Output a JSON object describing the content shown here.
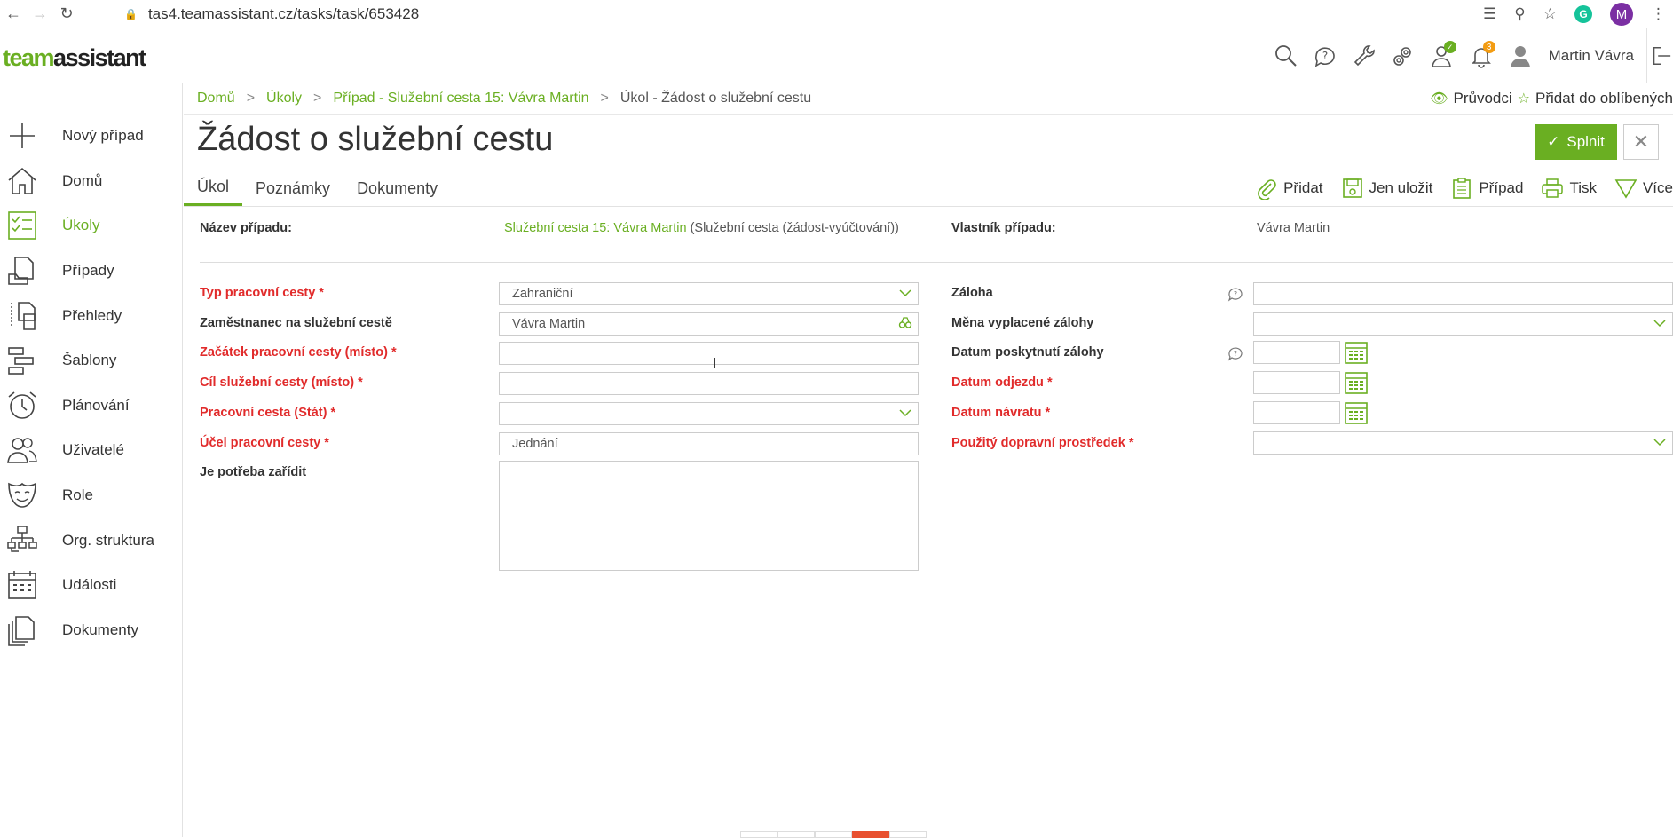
{
  "browser": {
    "url": "tas4.teamassistant.cz/tasks/task/653428",
    "profile_initial": "M",
    "grammarly": "G"
  },
  "app": {
    "logo_team": "team",
    "logo_assistant": "assistant",
    "user_name": "Martin Vávra",
    "notification_count": "3"
  },
  "sidebar": {
    "items": [
      {
        "label": "Nový případ",
        "icon": "plus-icon"
      },
      {
        "label": "Domů",
        "icon": "home-icon"
      },
      {
        "label": "Úkoly",
        "icon": "tasks-icon",
        "active": true
      },
      {
        "label": "Případy",
        "icon": "cases-icon"
      },
      {
        "label": "Přehledy",
        "icon": "overviews-icon"
      },
      {
        "label": "Šablony",
        "icon": "templates-icon"
      },
      {
        "label": "Plánování",
        "icon": "alarm-clock-icon"
      },
      {
        "label": "Uživatelé",
        "icon": "users-icon"
      },
      {
        "label": "Role",
        "icon": "mask-icon"
      },
      {
        "label": "Org. struktura",
        "icon": "org-chart-icon"
      },
      {
        "label": "Události",
        "icon": "calendar-icon"
      },
      {
        "label": "Dokumenty",
        "icon": "documents-icon"
      }
    ]
  },
  "breadcrumb": {
    "home": "Domů",
    "tasks": "Úkoly",
    "case": "Případ - Služební cesta 15: Vávra Martin",
    "current": "Úkol - Žádost o služební cestu",
    "guide": "Průvodci",
    "favorite": "Přidat do oblíbených"
  },
  "page": {
    "title": "Žádost o služební cestu",
    "done_button": "Splnit"
  },
  "tabs": [
    "Úkol",
    "Poznámky",
    "Dokumenty"
  ],
  "toolbar": {
    "add": "Přidat",
    "save_only": "Jen uložit",
    "case": "Případ",
    "print": "Tisk",
    "more": "Více"
  },
  "case_info": {
    "case_name_label": "Název případu:",
    "case_name_link": "Služební cesta 15: Vávra Martin",
    "case_name_suffix": "(Služební cesta (žádost-vyúčtování))",
    "owner_label": "Vlastník případu:",
    "owner_value": "Vávra Martin"
  },
  "form_left": {
    "trip_type_label": "Typ pracovní cesty *",
    "trip_type_value": "Zahraniční",
    "employee_label": "Zaměstnanec na služební cestě",
    "employee_value": "Vávra Martin",
    "start_label": "Začátek pracovní cesty (místo) *",
    "start_value": "",
    "dest_label": "Cíl služební cesty (místo) *",
    "dest_value": "",
    "country_label": "Pracovní cesta (Stát) *",
    "country_value": "",
    "purpose_label": "Účel pracovní cesty *",
    "purpose_value": "Jednání",
    "needs_label": "Je potřeba zařídit",
    "needs_value": ""
  },
  "form_right": {
    "advance_label": "Záloha",
    "advance_value": "",
    "currency_label": "Měna vyplacené zálohy",
    "currency_value": "",
    "advance_date_label": "Datum poskytnutí zálohy",
    "departure_label": "Datum odjezdu *",
    "return_label": "Datum návratu *",
    "transport_label": "Použitý dopravní prostředek *",
    "transport_value": ""
  },
  "colors": {
    "accent": "#6aaf22",
    "required": "#e12b2b",
    "badge": "#f39c12"
  }
}
